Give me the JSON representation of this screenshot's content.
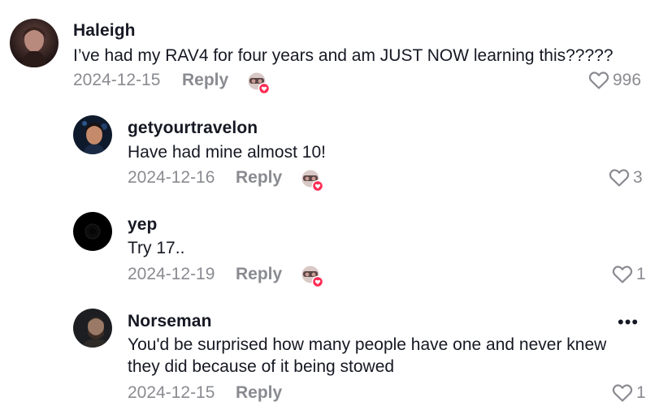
{
  "comments": [
    {
      "username": "Haleigh",
      "text": "I’ve had my RAV4 for four years and am JUST NOW learning this?????",
      "date": "2024-12-15",
      "reply_label": "Reply",
      "likes": "996"
    },
    {
      "username": "getyourtravelon",
      "text": "Have had mine almost 10!",
      "date": "2024-12-16",
      "reply_label": "Reply",
      "likes": "3"
    },
    {
      "username": "yep",
      "text": "Try 17..",
      "date": "2024-12-19",
      "reply_label": "Reply",
      "likes": "1"
    },
    {
      "username": "Norseman",
      "text_lines": [
        "You'd be surprised how many people have one and never knew",
        "they did because of it being stowed"
      ],
      "date": "2024-12-15",
      "reply_label": "Reply",
      "likes": "1",
      "more_label": "•••"
    }
  ],
  "colors": {
    "text": "#161823",
    "muted": "#8a8b91",
    "heart_badge": "#fe2c55"
  },
  "icons": {
    "like": "heart-outline-icon",
    "creator_liked": "creator-liked-badge-icon",
    "more": "more-options-icon"
  }
}
